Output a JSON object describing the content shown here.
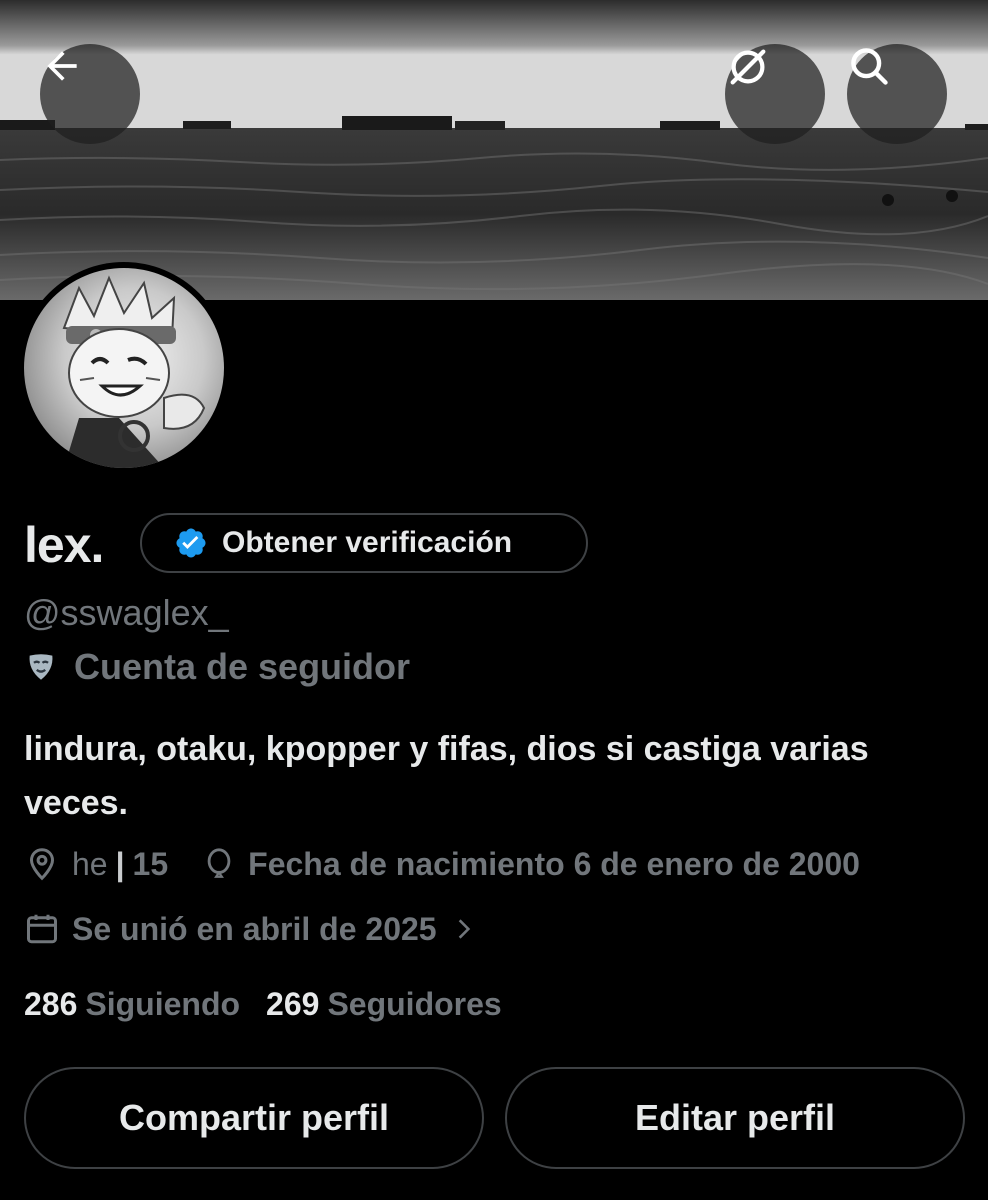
{
  "header": {
    "back_icon": "arrow-left-icon",
    "grok_icon": "slash-circle-icon",
    "search_icon": "search-icon"
  },
  "profile": {
    "name": "lex.",
    "verification_label": "Obtener verificación",
    "handle": "@sswaglex_",
    "account_label": "Cuenta de seguidor",
    "bio": "lindura, otaku, kpopper y fifas, dios si castiga varias veces.",
    "location_prefix": "he",
    "location_sep": "|",
    "location_suffix": "15",
    "birthdate": "Fecha de nacimiento 6 de enero de 2000",
    "joined": "Se unió en abril de 2025",
    "following_count": "286",
    "following_label": "Siguiendo",
    "followers_count": "269",
    "followers_label": "Seguidores"
  },
  "actions": {
    "share_label": "Compartir perfil",
    "edit_label": "Editar perfil"
  },
  "colors": {
    "background": "#000000",
    "text_primary": "#e7e9ea",
    "text_secondary": "#71767b",
    "verified_blue": "#1d9bf0",
    "border": "#3e4144"
  }
}
